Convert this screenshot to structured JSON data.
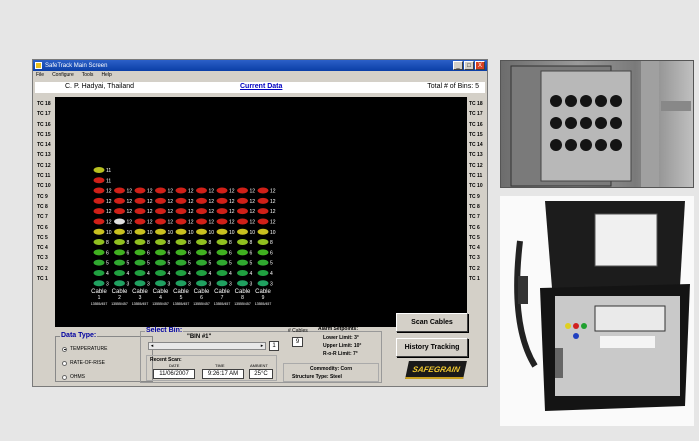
{
  "window": {
    "title": "SafeTrack Main Screen",
    "menu": [
      "File",
      "Configure",
      "Tools",
      "Help"
    ],
    "controls": [
      "_",
      "□",
      "X"
    ]
  },
  "header": {
    "location": "C. P. Hadyai, Thailand",
    "view": "Current Data",
    "total_bins": "Total # of Bins: 5"
  },
  "tc_labels": [
    "TC 18",
    "TC 17",
    "TC 16",
    "TC 15",
    "TC 14",
    "TC 13",
    "TC 12",
    "TC 11",
    "TC 10",
    "TC 9",
    "TC 8",
    "TC 7",
    "TC 6",
    "TC 5",
    "TC 4",
    "TC 3",
    "TC 2",
    "TC 1"
  ],
  "cables": [
    {
      "label": "Cable",
      "num": "1",
      "id": "13555/457"
    },
    {
      "label": "Cable",
      "num": "2",
      "id": "13555/457"
    },
    {
      "label": "Cable",
      "num": "3",
      "id": "13555/457"
    },
    {
      "label": "Cable",
      "num": "4",
      "id": "13555/457"
    },
    {
      "label": "Cable",
      "num": "5",
      "id": "13555/457"
    },
    {
      "label": "Cable",
      "num": "6",
      "id": "13555/457"
    },
    {
      "label": "Cable",
      "num": "7",
      "id": "13555/457"
    },
    {
      "label": "Cable",
      "num": "8",
      "id": "13555/457"
    },
    {
      "label": "Cable",
      "num": "9",
      "id": "13555/457"
    }
  ],
  "sensor_rows": [
    {
      "tc": 12,
      "color": "#b8c020",
      "value": "11",
      "cables": 1
    },
    {
      "tc": 11,
      "color": "#d02018",
      "value": "11",
      "cables": 1
    },
    {
      "tc": 10,
      "color": "#d02018",
      "value": "12",
      "cables": 9
    },
    {
      "tc": 9,
      "color": "#d02018",
      "value": "12",
      "cables": 9
    },
    {
      "tc": 8,
      "color": "#d02018",
      "value": "12",
      "cables": 9
    },
    {
      "tc": 7,
      "color": "#d02018",
      "value": "12",
      "cables": 9
    },
    {
      "tc": 6,
      "color": "#c8c020",
      "value": "10",
      "cables": 9
    },
    {
      "tc": 5,
      "color": "#90c020",
      "value": "8",
      "cables": 9
    },
    {
      "tc": 4,
      "color": "#40b020",
      "value": "6",
      "cables": 9
    },
    {
      "tc": 3,
      "color": "#30a830",
      "value": "5",
      "cables": 9
    },
    {
      "tc": 2,
      "color": "#20a040",
      "value": "4",
      "cables": 9
    },
    {
      "tc": 1,
      "color": "#20a060",
      "value": "3",
      "cables": 9
    }
  ],
  "data_type": {
    "title": "Data Type:",
    "options": [
      "TEMPERATURE",
      "RATE-OF-RISE",
      "OHMS"
    ]
  },
  "select_bin": {
    "title": "Select Bin:",
    "bin_name": "\"BIN #1\"",
    "bin_number": "1",
    "cables_label": "# Cables",
    "cables_value": "9"
  },
  "recent_scan": {
    "title": "Recent Scan:",
    "date_label": "DATE",
    "date": "11/06/2007",
    "time_label": "TIME",
    "time": "9:26:17 AM",
    "ambient_label": "AMBIENT",
    "ambient": "25°C"
  },
  "alarm": {
    "title": "Alarm Setpoints:",
    "lower": "Lower Limit: 3°",
    "upper": "Upper Limit: 10°",
    "ror": "R-o-R Limit:   7°"
  },
  "commodity": {
    "commodity": "Commodity:  Corn",
    "structure": "Structure Type:  Steel"
  },
  "buttons": {
    "scan": "Scan Cables",
    "history": "History Tracking"
  },
  "logo": "SAFEGRAIN",
  "colors": {
    "accent": "#0000a0",
    "screen_bg": "#000000"
  }
}
